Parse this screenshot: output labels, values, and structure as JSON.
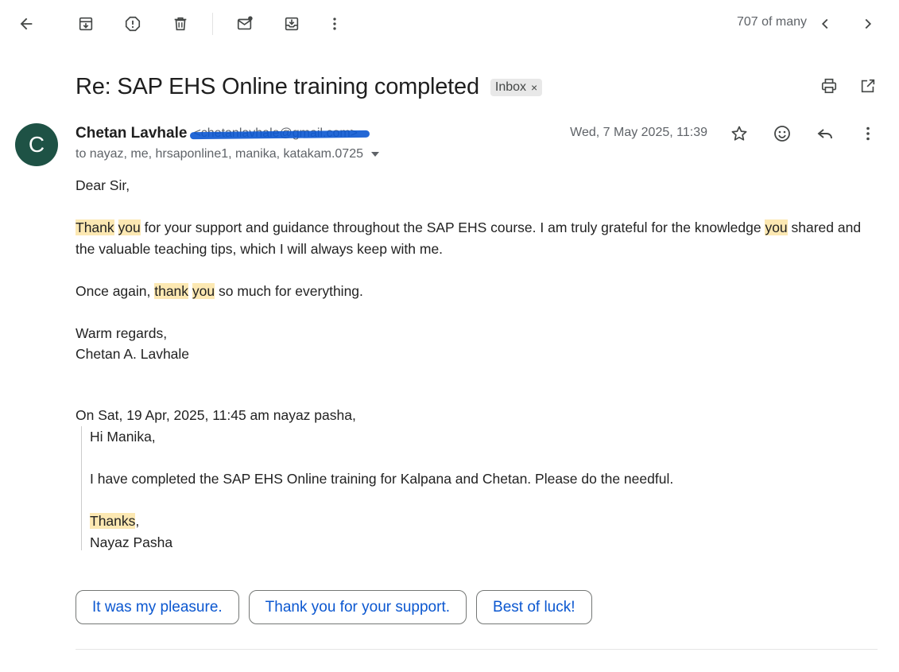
{
  "toolbar": {
    "back": "arrow-back-icon",
    "archive": "archive-icon",
    "spam": "report-spam-icon",
    "delete": "trash-icon",
    "unread": "mark-unread-icon",
    "move": "move-to-icon",
    "more": "more-vert-icon",
    "count": "707 of many"
  },
  "email": {
    "subject": "Re: SAP EHS Online training completed",
    "label": "Inbox",
    "label_close": "×",
    "sender_name": "Chetan Lavhale",
    "sender_email": "<chetanlavhale@gmail.com>",
    "recipients": "to nayaz, me, hrsaponline1, manika, katakam.0725",
    "date": "Wed, 7 May 2025, 11:39",
    "avatar_letter": "C",
    "avatar_color": "#1e5245"
  },
  "body": {
    "greeting": "Dear Sir,",
    "p1_hl1": "Thank",
    "p1_hl2": "you",
    "p1_text1": " for your support and guidance throughout the SAP EHS course. I am truly grateful for the knowledge ",
    "p1_hl3": "you",
    "p1_text2": " shared and the valuable teaching tips, which I will always keep with me.",
    "p2_text1": "Once again, ",
    "p2_hl1": "thank",
    "p2_hl2": "you",
    "p2_text2": " so much for everything.",
    "closing": "Warm regards,",
    "signature": "Chetan A. Lavhale"
  },
  "quoted": {
    "intro": "On Sat, 19 Apr, 2025, 11:45 am nayaz pasha,",
    "greeting": "Hi Manika,",
    "text": "I have completed the SAP EHS Online training for Kalpana and Chetan. Please do the needful.",
    "thanks": "Thanks",
    "thanks_comma": ",",
    "signature": "Nayaz Pasha"
  },
  "smart_replies": [
    "It was my pleasure.",
    "Thank you for your support.",
    "Best of luck!"
  ],
  "colors": {
    "highlight": "#fce8b2",
    "accent": "#0b57d0"
  }
}
